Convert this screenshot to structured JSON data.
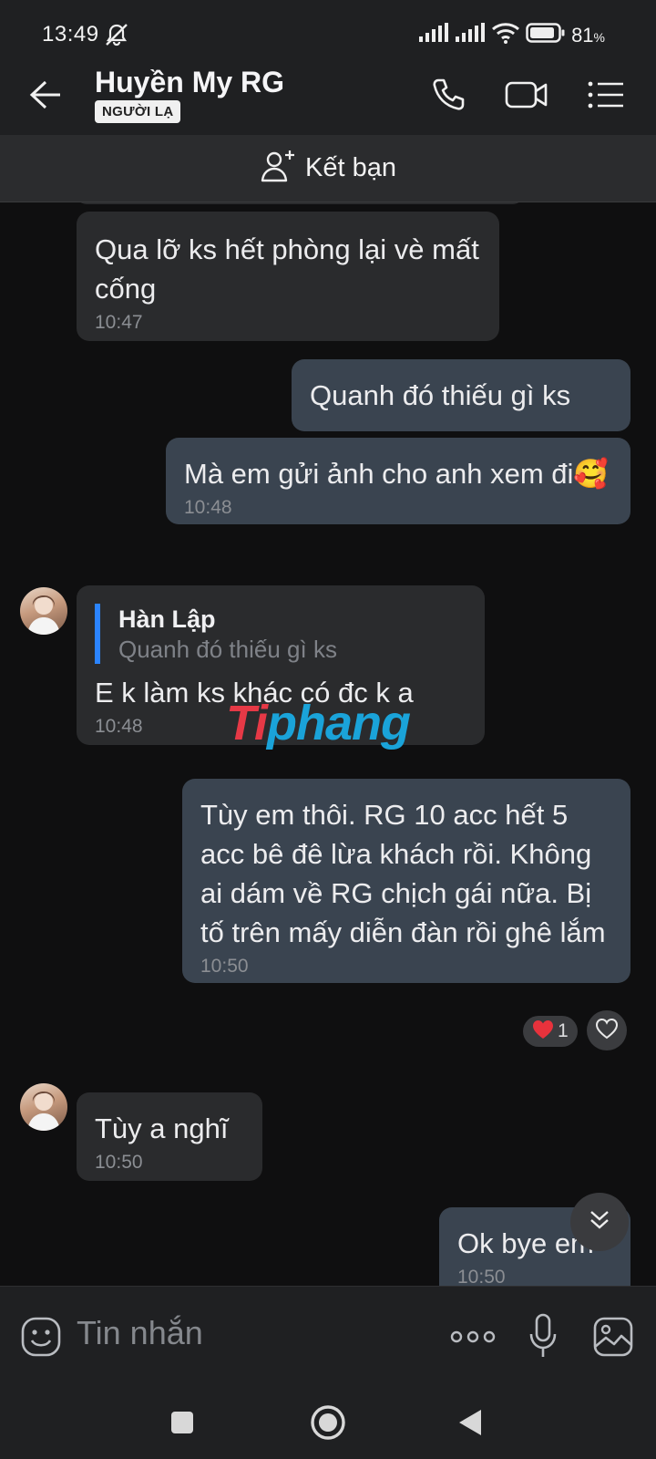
{
  "status_bar": {
    "time": "13:49",
    "battery_percent": "81",
    "battery_unit": "%",
    "icons": [
      "mute-icon",
      "signal-icon",
      "signal-icon",
      "wifi-icon",
      "battery-icon"
    ]
  },
  "header": {
    "contact_name": "Huyền My RG",
    "badge": "NGƯỜI LẠ",
    "icons": [
      "back-arrow-icon",
      "phone-icon",
      "video-call-icon",
      "menu-icon"
    ]
  },
  "add_friend": {
    "label": "Kết bạn",
    "icon": "add-person-icon"
  },
  "messages": [
    {
      "direction": "in",
      "text": "Qua lỡ ks hết phòng lại vè mất cống",
      "time": "10:47"
    },
    {
      "direction": "out",
      "text": "Quanh đó thiếu gì ks",
      "time": ""
    },
    {
      "direction": "out",
      "text": "Mà em gửi ảnh cho anh xem đi🥰",
      "time": "10:48"
    },
    {
      "direction": "in",
      "quote_name": "Hàn Lập",
      "quote_text": "Quanh đó thiếu gì ks",
      "text": "E k làm ks khác có đc k a",
      "time": "10:48"
    },
    {
      "direction": "out",
      "text": "Tùy em thôi. RG 10 acc hết 5 acc bê đê lừa khách rồi. Không ai dám về RG chịch gái nữa. Bị tố trên mấy diễn đàn rồi ghê lắm",
      "time": "10:50",
      "reaction": {
        "emoji": "❤️",
        "count": "1"
      }
    },
    {
      "direction": "in",
      "text": "Tùy a nghĩ",
      "time": "10:50"
    },
    {
      "direction": "out",
      "text": "Ok bye em",
      "time": "10:50"
    }
  ],
  "watermark": {
    "part_a": "Ti",
    "part_b": "phang"
  },
  "input_bar": {
    "placeholder": "Tin nhắn",
    "icons": [
      "emoji-icon",
      "more-icon",
      "microphone-icon",
      "image-icon"
    ]
  },
  "nav_bar": {
    "icons": [
      "recents-icon",
      "home-icon",
      "back-icon"
    ]
  },
  "colors": {
    "background": "#0f0f10",
    "bar": "#1f2022",
    "incoming_bubble": "#2a2b2d",
    "outgoing_bubble": "#3a4450",
    "quote_accent": "#2b84ff"
  }
}
